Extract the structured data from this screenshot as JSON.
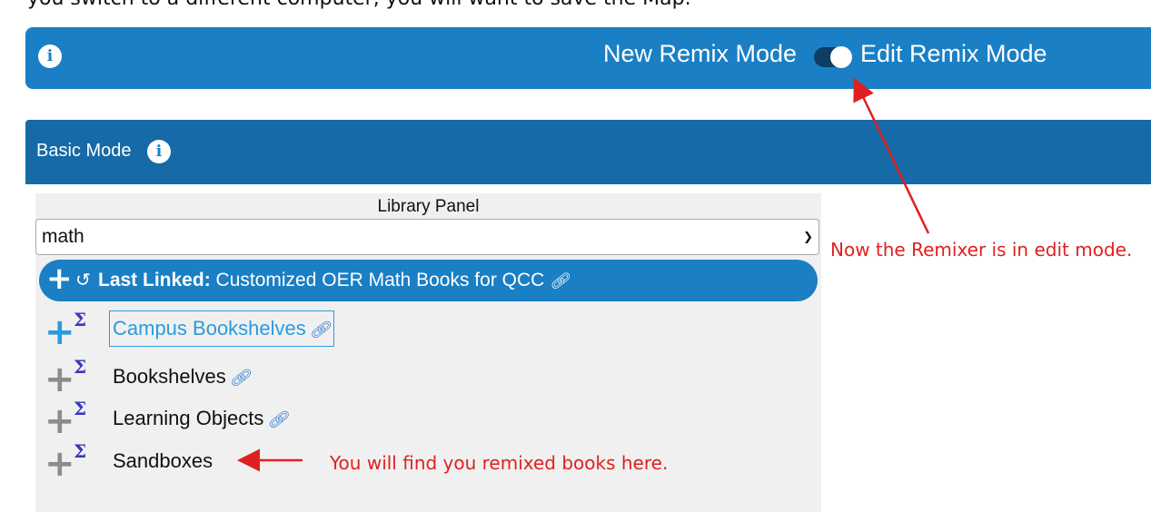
{
  "intro": {
    "text": "you switch to a different computer, you will want to save the Map."
  },
  "mode_bar": {
    "new_mode_label": "New Remix Mode",
    "edit_mode_label": "Edit Remix Mode",
    "toggle_state": "edit",
    "info_glyph": "i"
  },
  "basic_mode": {
    "title": "Basic Mode",
    "info_glyph": "i"
  },
  "library_panel": {
    "title": "Library Panel",
    "select_value": "math",
    "last_linked": {
      "prefix": "Last Linked:",
      "title": "Customized OER Math Books for QCC"
    },
    "items": [
      {
        "label": "Campus Bookshelves",
        "has_link": true,
        "active": true
      },
      {
        "label": "Bookshelves",
        "has_link": true,
        "active": false
      },
      {
        "label": "Learning Objects",
        "has_link": true,
        "active": false
      },
      {
        "label": "Sandboxes",
        "has_link": false,
        "active": false
      }
    ]
  },
  "annotations": {
    "edit_mode_note": "Now the Remixer is in edit mode.",
    "sandbox_note": "You will find you remixed books here."
  },
  "colors": {
    "mode_bar": "#1a7fc4",
    "basic_bar": "#166aa7",
    "annotation": "#e02020",
    "sigma": "#3838c0"
  }
}
